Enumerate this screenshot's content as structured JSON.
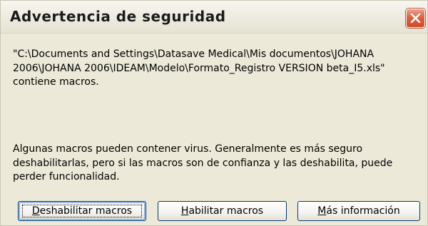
{
  "dialog": {
    "title": "Advertencia de seguridad",
    "close_icon": "close-icon",
    "close_color": "#e2603f"
  },
  "message": {
    "lines": [
      "\"C:\\Documents and Settings\\Datasave Medical\\Mis documentos\\JOHANA",
      "2006\\JOHANA 2006\\IDEAM\\Modelo\\Formato_Registro VERSION beta_I5.xls\"",
      "contiene macros."
    ]
  },
  "warning": {
    "lines": [
      "Algunas macros pueden contener virus. Generalmente es más seguro",
      "deshabilitarlas, pero si las macros son de confianza y las deshabilita, puede",
      "perder funcionalidad."
    ]
  },
  "buttons": {
    "disable": {
      "accel": "D",
      "rest": "eshabilitar macros"
    },
    "enable": {
      "accel": "H",
      "rest": "abilitar macros"
    },
    "more": {
      "accel": "M",
      "rest": "ás información"
    }
  }
}
